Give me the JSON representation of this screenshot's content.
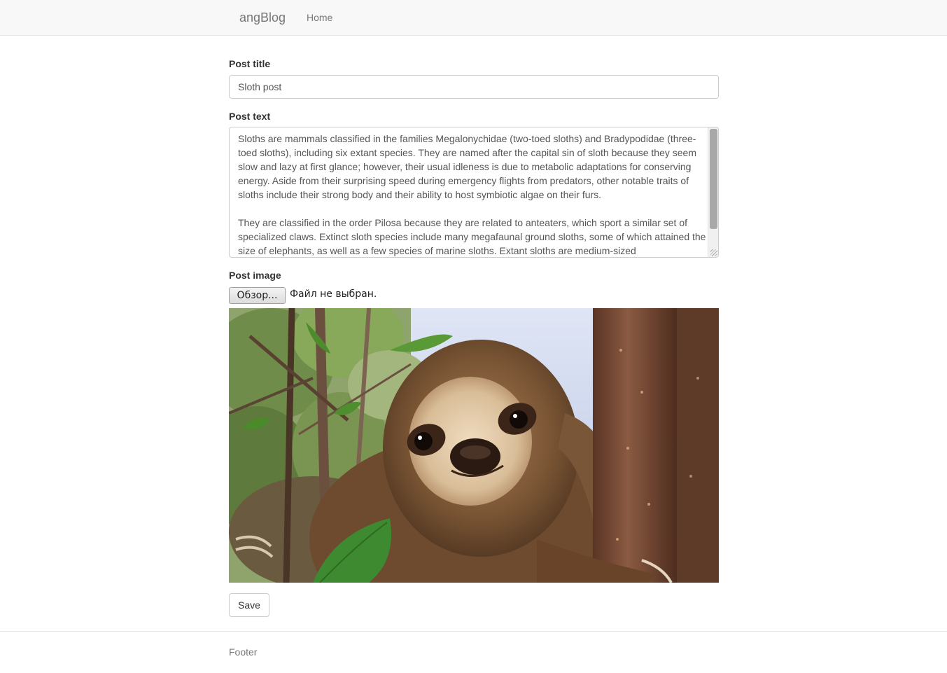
{
  "navbar": {
    "brand": "angBlog",
    "links": [
      {
        "label": "Home"
      }
    ]
  },
  "form": {
    "title_label": "Post title",
    "title_value": "Sloth post",
    "text_label": "Post text",
    "text_value": "Sloths are mammals classified in the families Megalonychidae (two-toed sloths) and Bradypodidae (three-toed sloths), including six extant species. They are named after the capital sin of sloth because they seem slow and lazy at first glance; however, their usual idleness is due to metabolic adaptations for conserving energy. Aside from their surprising speed during emergency flights from predators, other notable traits of sloths include their strong body and their ability to host symbiotic algae on their furs.\n\nThey are classified in the order Pilosa because they are related to anteaters, which sport a similar set of specialized claws. Extinct sloth species include many megafaunal ground sloths, some of which attained the size of elephants, as well as a few species of marine sloths. Extant sloths are medium-sized",
    "image_label": "Post image",
    "file_button": "Обзор...",
    "file_status": "Файл не выбран.",
    "save_label": "Save"
  },
  "footer": {
    "text": "Footer"
  }
}
